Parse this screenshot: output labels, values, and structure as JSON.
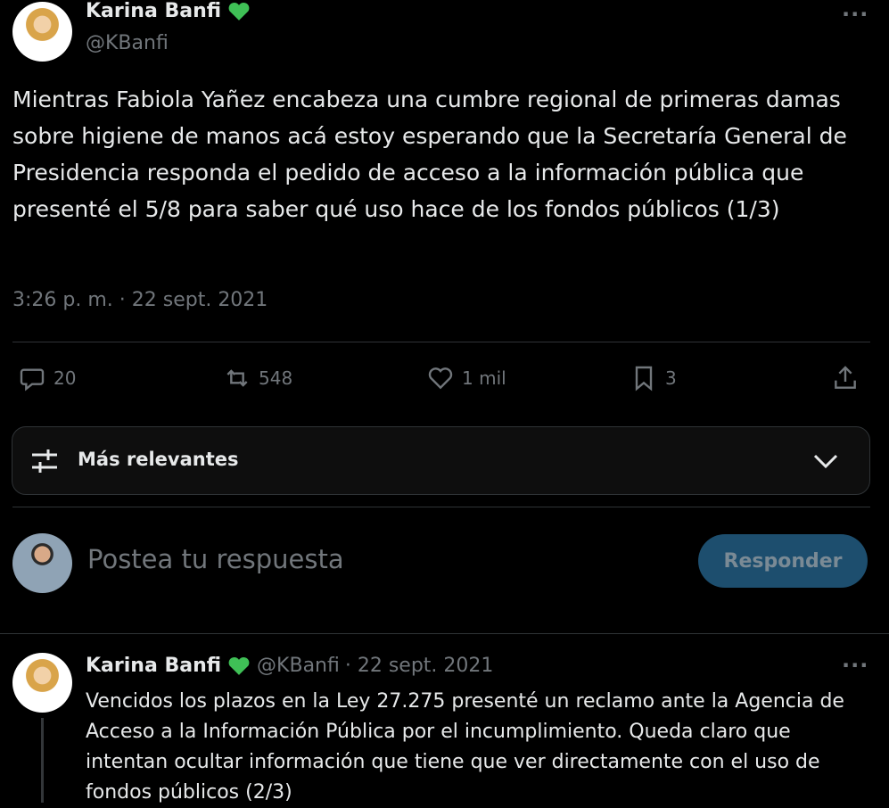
{
  "tweet": {
    "author_name": "Karina Banfi",
    "author_handle": "@KBanfi",
    "text": "Mientras Fabiola Yañez encabeza una cumbre regional de primeras damas sobre higiene de manos acá estoy esperando que la Secretaría General de Presidencia responda el pedido de acceso a la información pública que presenté el 5/8 para saber qué uso hace de los fondos públicos (1/3)",
    "timestamp": "3:26 p. m. · 22 sept. 2021",
    "more_label": "···",
    "verified_color": "#3fc056",
    "actions": {
      "replies": "20",
      "reposts": "548",
      "likes": "1 mil",
      "bookmarks": "3"
    }
  },
  "sort": {
    "label": "Más relevantes"
  },
  "compose": {
    "placeholder": "Postea tu respuesta",
    "button_label": "Responder"
  },
  "reply": {
    "author_name": "Karina Banfi",
    "author_handle": "@KBanfi",
    "date": "· 22 sept. 2021",
    "text": "Vencidos los plazos en la Ley 27.275 presenté un reclamo ante la Agencia de Acceso a la Información Pública por el incumplimiento. Queda claro que intentan ocultar información que tiene que ver directamente con el uso de fondos públicos (2/3)",
    "more_label": "···"
  },
  "colors": {
    "background": "#000000",
    "text": "#e7e9ea",
    "muted": "#71767b",
    "divider": "#2f3336",
    "button": "#1d4e6e"
  }
}
